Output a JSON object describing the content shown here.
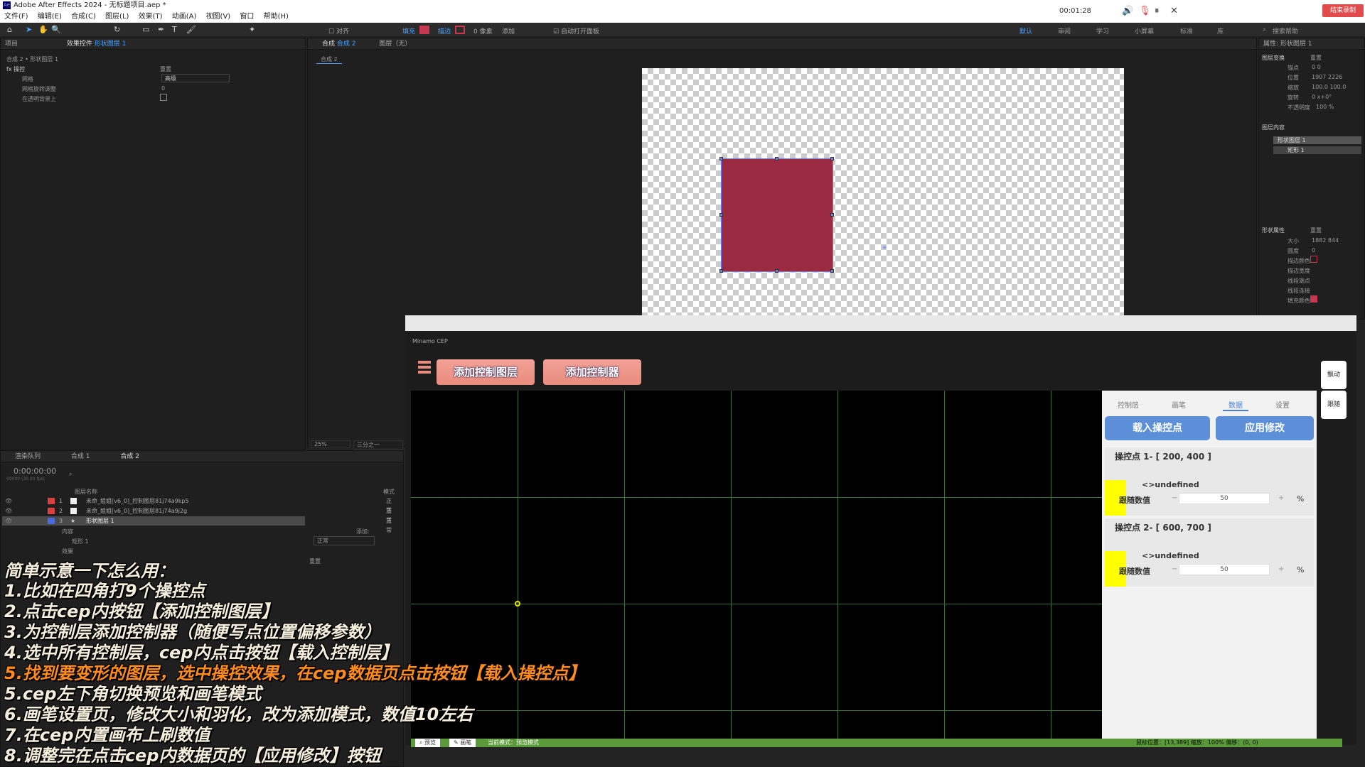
{
  "app": {
    "title": "Adobe After Effects 2024 - 无标题项目.aep *",
    "menu": [
      "文件(F)",
      "编辑(E)",
      "合成(C)",
      "图层(L)",
      "效果(T)",
      "动画(A)",
      "视图(V)",
      "窗口",
      "帮助(H)"
    ]
  },
  "recorder": {
    "time": "00:01:28",
    "stop_label": "结束录制"
  },
  "toolbar": {
    "align": "对齐",
    "fill": "填充",
    "stroke": "描边",
    "stroke_px": "0 像素",
    "add": "添加",
    "auto_open": "自动打开面板",
    "workspaces": [
      "默认",
      "审阅",
      "学习",
      "小屏幕",
      "标准",
      "库"
    ],
    "search": "搜索帮助"
  },
  "project_panel": {
    "tab_project": "项目",
    "tab_effects": "效果控件",
    "tab_effects_layer": "形状图层 1",
    "breadcrumb": "合成 2 • 形状图层 1",
    "fx_name": "操控",
    "reset": "重置",
    "row1_label": "网格",
    "row1_value": "高级",
    "row2_label": "网格旋转调整",
    "row2_value": "0",
    "row3_label": "在透明背景上"
  },
  "comp_panel": {
    "tab": "合成",
    "tab_name": "合成 2",
    "layer_tab": "图层（无）",
    "subtab": "合成 2",
    "zoom": "25%",
    "res": "三分之一",
    "shape_color": "#9b2a43"
  },
  "right_panel": {
    "title": "属性: 形状图层 1",
    "section_transform": "图层变换",
    "reset": "重置",
    "rows": [
      {
        "label": "锚点",
        "value": "0    0"
      },
      {
        "label": "位置",
        "value": "1907   2226"
      },
      {
        "label": "缩放",
        "value": "100.0   100.0"
      },
      {
        "label": "旋转",
        "value": "0 x+0°"
      },
      {
        "label": "不透明度",
        "value": "100 %"
      }
    ],
    "section_contents": "图层内容",
    "contents": [
      "形状图层 1",
      "矩形 1"
    ],
    "section_shape": "形状属性",
    "shape_rows": [
      {
        "label": "大小",
        "value": "1882   844"
      },
      {
        "label": "圆度",
        "value": "0"
      },
      {
        "label": "描边颜色",
        "value": ""
      },
      {
        "label": "描边宽度",
        "value": ""
      },
      {
        "label": "线段端点",
        "value": ""
      },
      {
        "label": "线段连接",
        "value": ""
      },
      {
        "label": "填充颜色",
        "value": ""
      }
    ]
  },
  "timeline": {
    "tabs": [
      "渲染队列",
      "合成 1",
      "合成 2"
    ],
    "timecode": "0:00:00:00",
    "fps": "00000 (30.00 fps)",
    "col_name": "图层名称",
    "col_mode": "模式",
    "layers": [
      {
        "num": "1",
        "name": "未命_姐姐[v6_0]_控制图层81j74a9kp5",
        "mode": "正常",
        "color": "#d94040"
      },
      {
        "num": "2",
        "name": "未命_姐姐[v6_0]_控制图层81j74a9j2g",
        "mode": "正常",
        "color": "#d94040"
      },
      {
        "num": "3",
        "name": "形状图层 1",
        "mode": "正常",
        "color": "#4a6ad9"
      }
    ],
    "sub_content": "内容",
    "sub_add": "添加:",
    "sub_rect": "矩形 1",
    "sub_rect_mode": "正常",
    "sub_effects": "效果",
    "sub_reset": "重置"
  },
  "cep": {
    "header": "Minamo CEP",
    "btn_add_layer": "添加控制图层",
    "btn_add_ctrl": "添加控制器",
    "tabs": [
      "控制层",
      "画笔",
      "数据",
      "设置"
    ],
    "active_tab": "数据",
    "btn_load": "载入操控点",
    "btn_apply": "应用修改",
    "points": [
      {
        "title": "操控点 1- [ 200, 400 ]",
        "name": "<>undefined",
        "label": "跟随数值",
        "value": "50",
        "unit": "%"
      },
      {
        "title": "操控点 2- [ 600, 700 ]",
        "name": "<>undefined",
        "label": "跟随数值",
        "value": "50",
        "unit": "%"
      }
    ],
    "right_btns": [
      "飘动",
      "跟随"
    ],
    "status_preview": "预览",
    "status_brush": "画笔",
    "status_mode": "当前模式：预览模式",
    "status_right": "鼠标位置：[13,389]  缩放：100%  偏移：(0, 0)"
  },
  "overlay": {
    "lines": [
      "简单示意一下怎么用：",
      "1.比如在四角打9个操控点",
      "2.点击cep内按钮【添加控制图层】",
      "3.为控制层添加控制器（随便写点位置偏移参数）",
      "4.选中所有控制层，cep内点击按钮【载入控制层】",
      "5.找到要变形的图层，选中操控效果，在cep数据页点击按钮【载入操控点】",
      "5.cep左下角切换预览和画笔模式",
      "6.画笔设置页，修改大小和羽化，改为添加模式，数值10左右",
      "7.在cep内置画布上刷数值",
      "8.调整完在点击cep内数据页的【应用修改】按钮"
    ],
    "highlight_index": 5,
    "highlight_color": "#ff8c1a"
  }
}
